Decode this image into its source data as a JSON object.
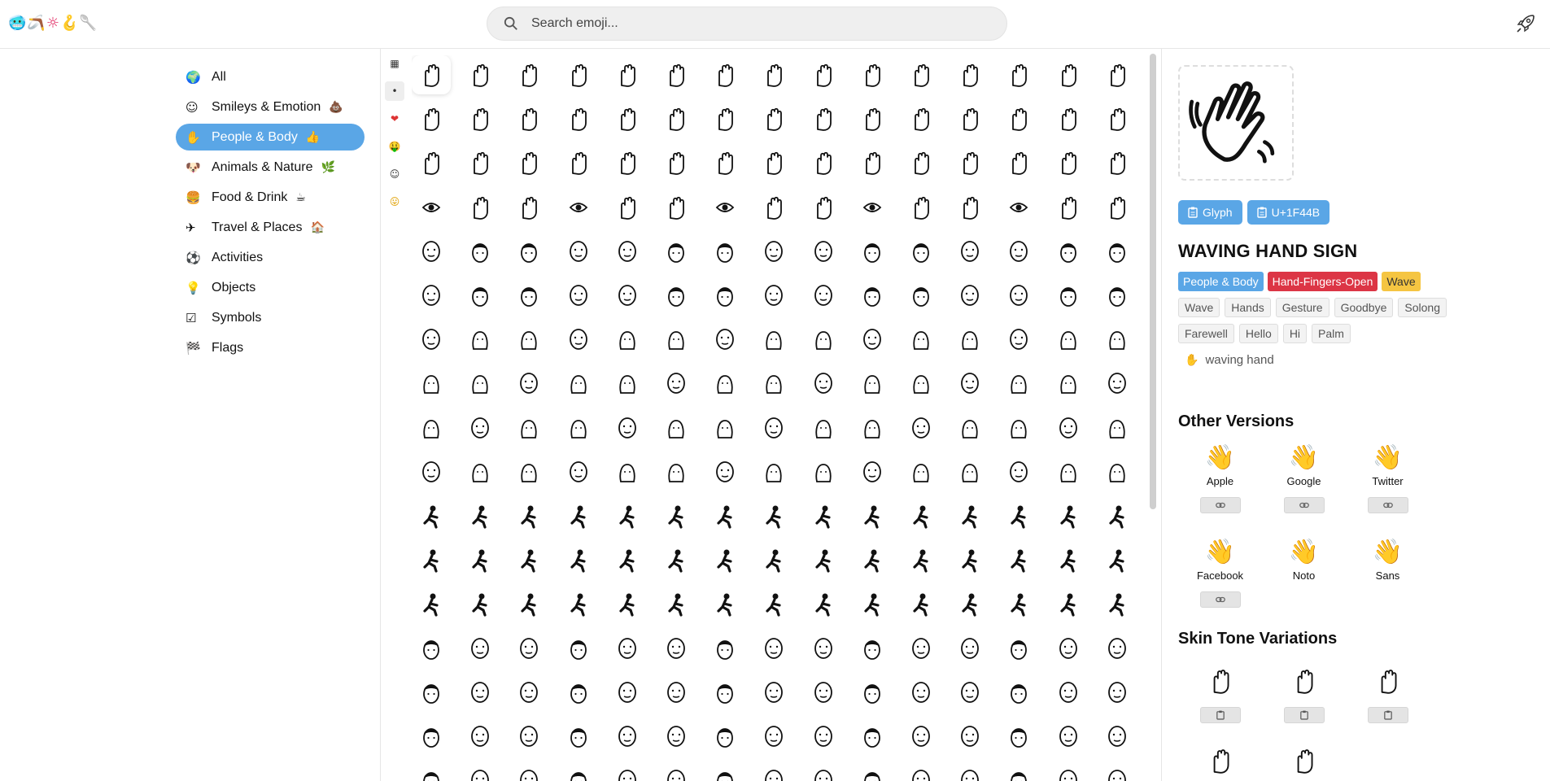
{
  "header": {
    "logo_text": "🥶🪃☼🪝🥄",
    "search_placeholder": "Search emoji..."
  },
  "sidebar": {
    "items": [
      {
        "label": "All",
        "extra": "",
        "icon": "globe-icon"
      },
      {
        "label": "Smileys & Emotion",
        "extra": "💩",
        "icon": "smiley-icon"
      },
      {
        "label": "People & Body",
        "extra": "👍",
        "icon": "hand-icon",
        "active": true
      },
      {
        "label": "Animals & Nature",
        "extra": "🌿",
        "icon": "dog-icon"
      },
      {
        "label": "Food & Drink",
        "extra": "☕",
        "icon": "burger-icon"
      },
      {
        "label": "Travel & Places",
        "extra": "🏠",
        "icon": "plane-icon"
      },
      {
        "label": "Activities",
        "extra": "",
        "icon": "soccer-ball-icon"
      },
      {
        "label": "Objects",
        "extra": "",
        "icon": "lightbulb-icon"
      },
      {
        "label": "Symbols",
        "extra": "",
        "icon": "checkbox-icon"
      },
      {
        "label": "Flags",
        "extra": "",
        "icon": "checkered-flag-icon"
      }
    ]
  },
  "subtabs": [
    "grid-icon",
    "dot-icon",
    "heart-icon",
    "money-face-icon",
    "face-outline-icon",
    "face-tongue-icon"
  ],
  "grid": {
    "columns": 15,
    "rows": 17,
    "selected_index": 0
  },
  "detail": {
    "glyph_button": "Glyph",
    "codepoint_button": "U+1F44B",
    "name": "WAVING HAND SIGN",
    "tags": [
      {
        "label": "People & Body",
        "color": "#5aa6e6"
      },
      {
        "label": "Hand-Fingers-Open",
        "color": "#dc3545"
      },
      {
        "label": "Wave",
        "color": "#f5c542"
      }
    ],
    "keywords": [
      "Wave",
      "Hands",
      "Gesture",
      "Goodbye",
      "Solong",
      "Farewell",
      "Hello",
      "Hi",
      "Palm"
    ],
    "cldr_name": "waving hand",
    "other_versions_title": "Other Versions",
    "versions": [
      {
        "label": "Apple",
        "glyph": "👋",
        "link": true
      },
      {
        "label": "Google",
        "glyph": "👋",
        "link": true
      },
      {
        "label": "Twitter",
        "glyph": "👋",
        "link": true
      },
      {
        "label": "Facebook",
        "glyph": "👋",
        "link": true
      },
      {
        "label": "Noto",
        "glyph": "👋",
        "link": false
      },
      {
        "label": "Sans",
        "glyph": "👋",
        "link": false
      }
    ],
    "skin_tones_title": "Skin Tone Variations",
    "skin_tones_count": 5
  },
  "colors": {
    "accent": "#5aa6e6",
    "red_tag": "#dc3545",
    "yellow_tag": "#f5c542"
  }
}
